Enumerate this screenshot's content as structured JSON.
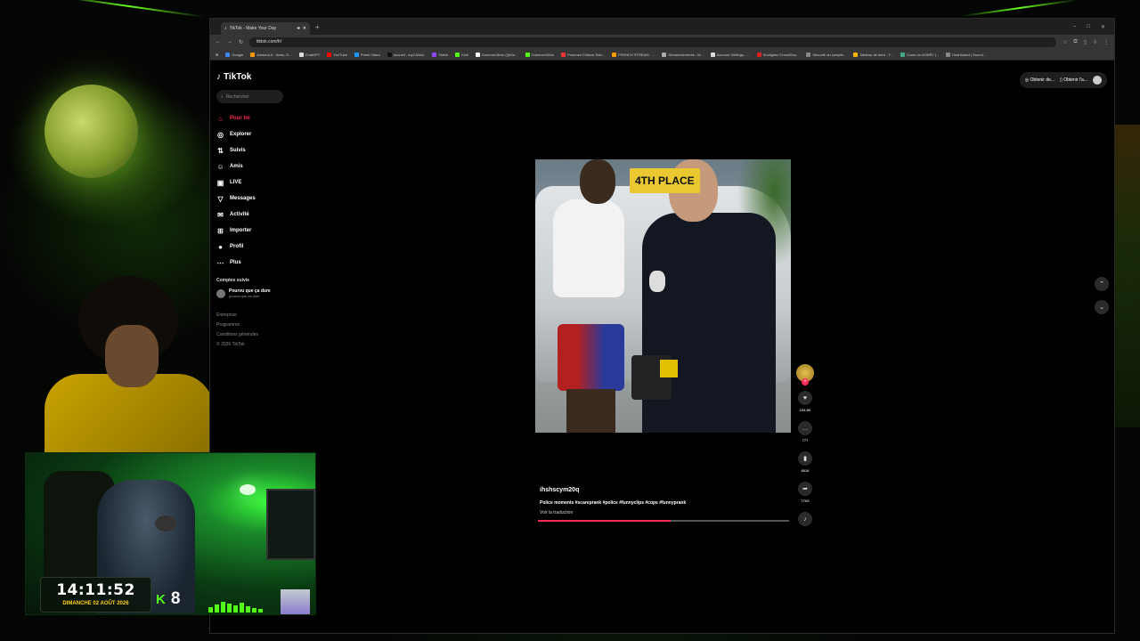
{
  "browser": {
    "tab_title": "TikTok - Make Your Day",
    "url": "tiktok.com/fr/",
    "bookmarks": [
      "Google",
      "Amazon.fr : livres, D...",
      "ChatGPT",
      "YouTube",
      "Prime Video",
      "Accueil - myCANAL",
      "Twitch",
      "Kick",
      "GuennerOlivin (@Gu...",
      "GuennerOlivin",
      "Pommes Chilene San...",
      "FRENCH STREAM - ...",
      "Streamelements - M...",
      "Account Settings - ...",
      "Soulignez CrowdSou...",
      "Sécurité du compte...",
      "Tableau de bord - T...",
      "Cours du AVWR7 |...",
      "Dashboard | Sound..."
    ]
  },
  "tiktok": {
    "logo": "TikTok",
    "search_placeholder": "Rechercher",
    "nav": [
      {
        "label": "Pour toi",
        "icon": "home-icon"
      },
      {
        "label": "Explorer",
        "icon": "compass-icon"
      },
      {
        "label": "Suivis",
        "icon": "following-icon"
      },
      {
        "label": "Amis",
        "icon": "friends-icon"
      },
      {
        "label": "LIVE",
        "icon": "live-icon"
      },
      {
        "label": "Messages",
        "icon": "messages-icon"
      },
      {
        "label": "Activité",
        "icon": "activity-icon"
      },
      {
        "label": "Importer",
        "icon": "upload-icon"
      },
      {
        "label": "Profil",
        "icon": "profile-icon"
      },
      {
        "label": "Plus",
        "icon": "more-icon"
      }
    ],
    "followed_title": "Comptes suivis",
    "followed_account": {
      "name": "Pourvu que ça dure",
      "handle": "pourvu.que.ca.dure"
    },
    "footer": [
      "Entreprise",
      "Programme",
      "Conditions générales",
      "© 2026 TikTok"
    ],
    "top_right": {
      "btn1": "Obtenir de...",
      "btn2": "Obtenir l'a..."
    },
    "video": {
      "overlay_text": "4TH PLACE",
      "author": "ihshscym20q",
      "caption": "Police moments #scareprank #police #funnyclips #cops #funnyprank",
      "translate": "Voir la traduction",
      "progress": 0.53,
      "likes": "154.9K",
      "comments": "777",
      "saves": "8016",
      "shares": "7765"
    }
  },
  "stream_overlay": {
    "time": "14:11:52",
    "date": "DIMANCHE 02 AOÛT 2026",
    "kick_logo": "K",
    "viewer_count": "8"
  },
  "colors": {
    "accent": "#fe2c55",
    "kick": "#53fc18"
  }
}
